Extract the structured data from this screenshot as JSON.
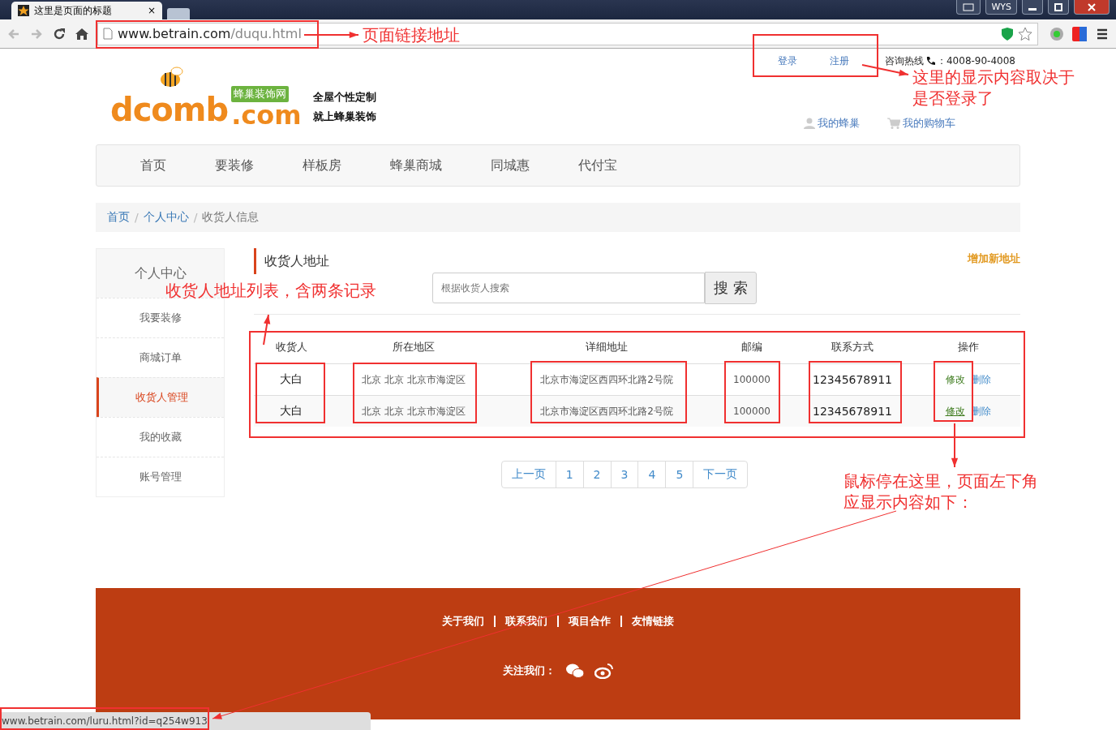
{
  "browser": {
    "tab_title": "这里是页面的标题",
    "tab_close": "×",
    "breadcrumb_separator": "/",
    "window_label": "WYS",
    "address_host": "www.betrain.com",
    "address_path": "/duqu.html"
  },
  "header": {
    "links": [
      "登录",
      "注册"
    ],
    "hotline_label": "咨询热线",
    "hotline_number": "：4008-90-4008",
    "logo_word": "dcomb",
    "logo_domain": ".com",
    "logo_badge": "蜂巢装饰网",
    "slogans": [
      "全屋个性定制",
      "就上蜂巢装饰"
    ],
    "user_links": [
      "我的蜂巢",
      "我的购物车"
    ]
  },
  "nav": [
    "首页",
    "要装修",
    "样板房",
    "蜂巢商城",
    "同城惠",
    "代付宝"
  ],
  "breadcrumb": [
    "首页",
    "个人中心",
    "收货人信息"
  ],
  "sidebar": {
    "title": "个人中心",
    "items": [
      {
        "label": "我要装修",
        "selected": false
      },
      {
        "label": "商城订单",
        "selected": false
      },
      {
        "label": "收货人管理",
        "selected": true
      },
      {
        "label": "我的收藏",
        "selected": false
      },
      {
        "label": "账号管理",
        "selected": false
      }
    ]
  },
  "content": {
    "title": "收货人地址",
    "add_link": "增加新地址",
    "search": {
      "placeholder": "根据收货人搜索",
      "button": "搜 索"
    },
    "table": {
      "columns": [
        "收货人",
        "所在地区",
        "详细地址",
        "邮编",
        "联系方式",
        "操作"
      ],
      "rows": [
        {
          "cells": [
            "大白",
            "北京 北京 北京市海淀区",
            "北京市海淀区西四环北路2号院",
            "100000",
            "12345678911"
          ],
          "edit": "修改",
          "delete": "删除",
          "hovered": false
        },
        {
          "cells": [
            "大白",
            "北京 北京 北京市海淀区",
            "北京市海淀区西四环北路2号院",
            "100000",
            "12345678911"
          ],
          "edit": "修改",
          "delete": "删除",
          "hovered": true
        }
      ]
    },
    "pagination": [
      "上一页",
      "1",
      "2",
      "3",
      "4",
      "5",
      "下一页"
    ]
  },
  "footer": {
    "links": [
      "关于我们",
      "联系我们",
      "项目合作",
      "友情链接"
    ],
    "follow_label": "关注我们："
  },
  "status_bar": {
    "url": "www.betrain.com/luru.html?id=q254w913"
  },
  "annotations": [
    "页面链接地址",
    "这里的显示内容取决于",
    "是否登录了",
    "收货人地址列表，含两条记录",
    "鼠标停在这里，页面左下角",
    "应显示内容如下："
  ]
}
